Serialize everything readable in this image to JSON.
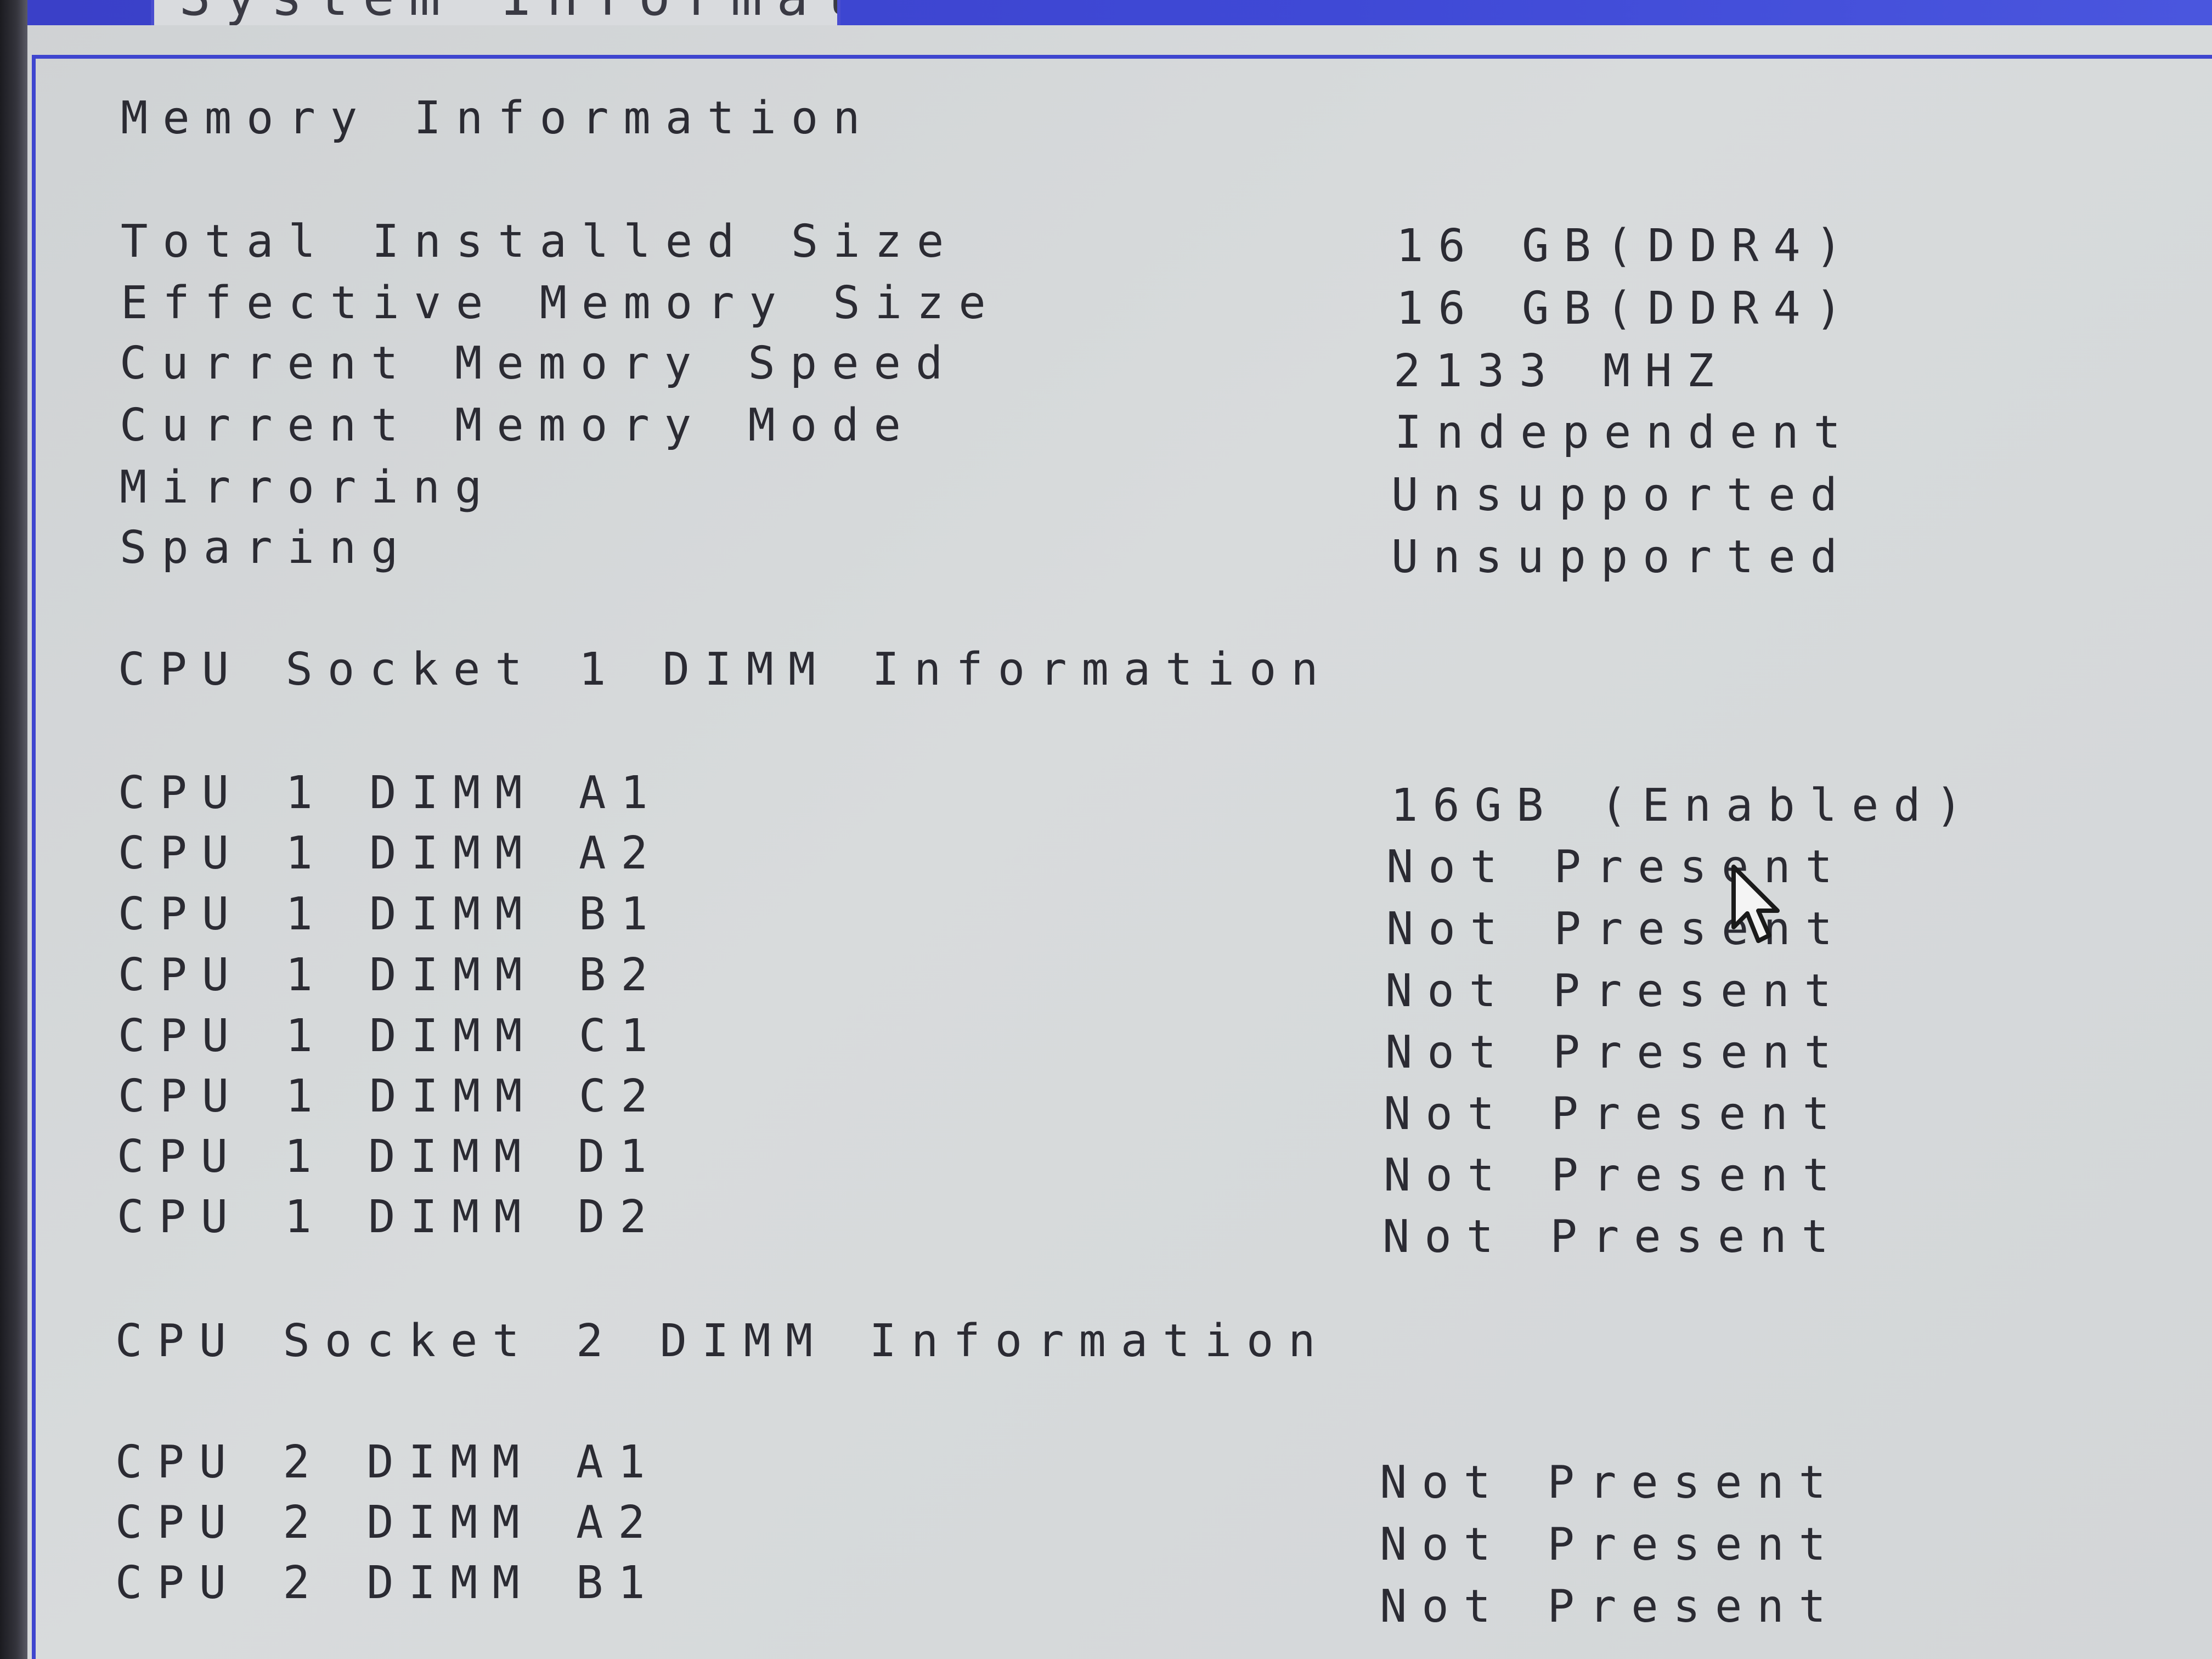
{
  "tab_title": "System Information",
  "memory_info": {
    "heading": "Memory Information",
    "rows": [
      {
        "label": "Total Installed Size",
        "value": "16 GB(DDR4)"
      },
      {
        "label": "Effective Memory Size",
        "value": "16 GB(DDR4)"
      },
      {
        "label": "Current Memory Speed",
        "value": "2133 MHZ"
      },
      {
        "label": "Current Memory Mode",
        "value": "Independent"
      },
      {
        "label": "Mirroring",
        "value": "Unsupported"
      },
      {
        "label": "Sparing",
        "value": "Unsupported"
      }
    ]
  },
  "socket1": {
    "heading": "CPU Socket 1 DIMM Information",
    "rows": [
      {
        "label": "CPU 1 DIMM A1",
        "value": "16GB (Enabled)"
      },
      {
        "label": "CPU 1 DIMM A2",
        "value": "Not Present"
      },
      {
        "label": "CPU 1 DIMM B1",
        "value": "Not Present"
      },
      {
        "label": "CPU 1 DIMM B2",
        "value": "Not Present"
      },
      {
        "label": "CPU 1 DIMM C1",
        "value": "Not Present"
      },
      {
        "label": "CPU 1 DIMM C2",
        "value": "Not Present"
      },
      {
        "label": "CPU 1 DIMM D1",
        "value": "Not Present"
      },
      {
        "label": "CPU 1 DIMM D2",
        "value": "Not Present"
      }
    ]
  },
  "socket2": {
    "heading": "CPU Socket 2 DIMM Information",
    "rows": [
      {
        "label": "CPU 2 DIMM A1",
        "value": "Not Present"
      },
      {
        "label": "CPU 2 DIMM A2",
        "value": "Not Present"
      },
      {
        "label": "CPU 2 DIMM B1",
        "value": "Not Present"
      }
    ]
  },
  "colors": {
    "header_blue": "#3f49d6",
    "panel_border": "#3e45cf",
    "screen_bg": "#d3d6d8",
    "text": "#2b2b33"
  },
  "icons": {
    "cursor": "mouse-pointer-icon"
  }
}
